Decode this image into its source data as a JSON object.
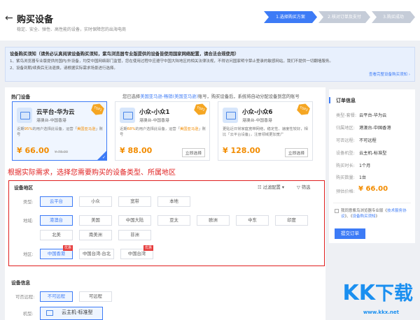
{
  "header": {
    "back_icon": "arrow-left-icon",
    "title": "购买设备",
    "subtitle": "稳定、安全、弹性、高性能的设备，实时保障您的出海电商"
  },
  "steps": [
    {
      "label": "1.选择购买方案",
      "active": true
    },
    {
      "label": "2.核对订单及支付",
      "active": false
    },
    {
      "label": "3.购买成功",
      "active": false
    }
  ],
  "notice": {
    "title": "设备购买须知（请务必认真阅读设备购买须知，紫鸟浏览器专业版提供的设备皆使用国家网络配置，请合法合规使用）",
    "line1": "1、紫鸟浏览器专业版提供的国内/外设备，均受中国网络部门监管，您在使用过程中应遵守中国大陆地区的相关法律法规，不得访问国家明令禁止登录的敏感网站，我们不提供一切翻墙服务。",
    "line2": "2、设备到期/续费后无法退换，请根据实际需求场景进行选择。",
    "link": "查看完整设备购买须知 ›"
  },
  "hot": {
    "title": "热门设备",
    "note_pre": "您已选择",
    "note_link": "美国亚马逊-畅销(美国亚马逊)",
    "note_post": "账号，购买设备后，系统将自动分配设备到您的账号",
    "cards": [
      {
        "name": "云平台-华为云",
        "region": "港澳台-中国香港",
        "desc_pre": "近期",
        "desc_hl1": "95%",
        "desc_mid": "的用户选择此设备，运营「",
        "desc_hl2": "美国亚马逊",
        "desc_post": "」账号",
        "price": "¥ 66.00",
        "oprice": "¥ 78.00",
        "tag": "TOP1",
        "selected": true,
        "buy": ""
      },
      {
        "name": "小众-小众1",
        "region": "港澳台-中国香港",
        "desc_pre": "近期",
        "desc_hl1": "68%",
        "desc_mid": "的用户选择此设备，运营「",
        "desc_hl2": "美国亚马逊",
        "desc_post": "」账号",
        "price": "¥ 88.00",
        "oprice": "",
        "tag": "TOP2",
        "selected": false,
        "buy": "立即选择"
      },
      {
        "name": "小众-小众6",
        "region": "港澳台-中国香港",
        "desc_pre": "更贴近日常家庭宽带网络，稳定性、速度性较好，相比「云平台设备」，注册领域更加宽广",
        "desc_hl1": "",
        "desc_mid": "",
        "desc_hl2": "",
        "desc_post": "",
        "price": "¥ 128.00",
        "oprice": "",
        "tag": "TOP3",
        "selected": false,
        "buy": "立即选择"
      }
    ]
  },
  "annotation": "根据实际需求，选择您需要购买的设备类型、所属地区",
  "region": {
    "title": "设备地区",
    "filter_config": "过滤配置 ▾",
    "filter": "筛选",
    "type_label": "类型:",
    "types": [
      "云平台",
      "小众",
      "宽带",
      "本地"
    ],
    "area_label": "地域:",
    "areas_row1": [
      "港澳台",
      "美国",
      "中国大陆",
      "亚太",
      "欧洲",
      "中东",
      "印度"
    ],
    "areas_row2": [
      "北美",
      "南美洲",
      "非洲"
    ],
    "place_label": "地区:",
    "places": [
      {
        "label": "中国香港",
        "badge": "优惠"
      },
      {
        "label": "中国台湾-台北",
        "badge": ""
      },
      {
        "label": "中国台湾",
        "badge": "优惠"
      }
    ]
  },
  "device_info": {
    "title": "设备信息",
    "remote_label": "可否远程:",
    "remote_opts": [
      "不可远程",
      "可远程"
    ],
    "model_label": "机型:",
    "model_value": "云主机-标准型"
  },
  "order": {
    "title": "订单信息",
    "rows": [
      {
        "k": "类型-套餐:",
        "v": "云平台-华为云"
      },
      {
        "k": "归属地区:",
        "v": "港澳台-中国香港"
      },
      {
        "k": "可否远程:",
        "v": "不可远程"
      },
      {
        "k": "设备机型:",
        "v": "云主机-标准型"
      },
      {
        "k": "购买时长:",
        "v": "1个月"
      },
      {
        "k": "购买数量:",
        "v": "1台"
      }
    ],
    "price_label": "预估价格:",
    "price": "¥ 66.00",
    "agree_pre": "我同意紫鸟浏览器专业版《",
    "agree_link1": "技术服务协议",
    "agree_mid": "》、《",
    "agree_link2": "设备购买须知",
    "agree_post": "》",
    "submit": "提交订单"
  },
  "watermark": {
    "text_a": "KK",
    "text_b": "下载",
    "url": "www.kkx.net"
  },
  "colors": {
    "accent": "#3d7bf6",
    "price": "#f28c00",
    "annotation": "#e02020"
  }
}
